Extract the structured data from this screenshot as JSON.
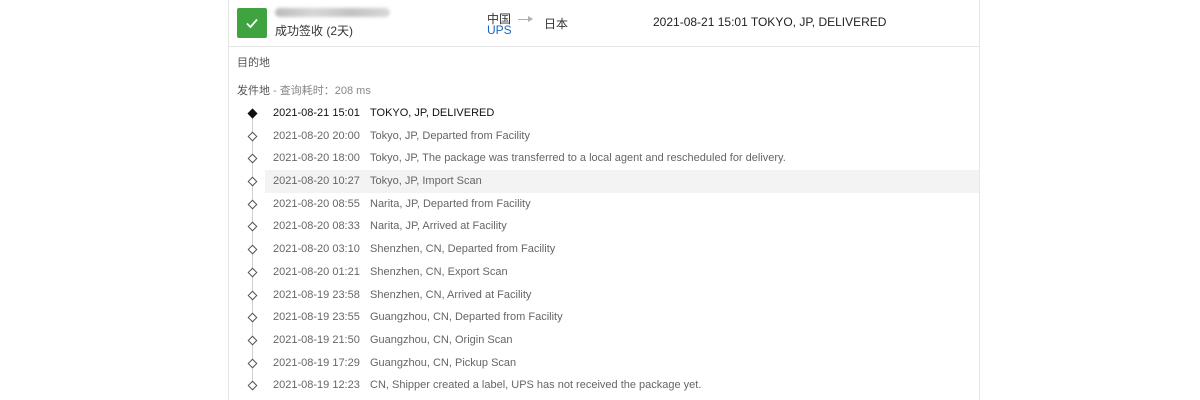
{
  "summary": {
    "status": "成功签收 (2天)",
    "origin_country": "中国",
    "carrier": "UPS",
    "destination_country": "日本",
    "latest_event": "2021-08-21 15:01 TOKYO, JP, DELIVERED",
    "status_color": "#3fa33f",
    "carrier_color": "#1a65c7"
  },
  "sections": {
    "destination_label": "目的地",
    "origin_label": "发件地",
    "query_time": " - 查询耗时：208 ms"
  },
  "events": [
    {
      "time": "2021-08-21 15:01",
      "desc": "TOKYO, JP, DELIVERED"
    },
    {
      "time": "2021-08-20 20:00",
      "desc": "Tokyo, JP, Departed from Facility"
    },
    {
      "time": "2021-08-20 18:00",
      "desc": "Tokyo, JP, The package was transferred to a local agent and rescheduled for delivery."
    },
    {
      "time": "2021-08-20 10:27",
      "desc": "Tokyo, JP, Import Scan"
    },
    {
      "time": "2021-08-20 08:55",
      "desc": "Narita, JP, Departed from Facility"
    },
    {
      "time": "2021-08-20 08:33",
      "desc": "Narita, JP, Arrived at Facility"
    },
    {
      "time": "2021-08-20 03:10",
      "desc": "Shenzhen, CN, Departed from Facility"
    },
    {
      "time": "2021-08-20 01:21",
      "desc": "Shenzhen, CN, Export Scan"
    },
    {
      "time": "2021-08-19 23:58",
      "desc": "Shenzhen, CN, Arrived at Facility"
    },
    {
      "time": "2021-08-19 23:55",
      "desc": "Guangzhou, CN, Departed from Facility"
    },
    {
      "time": "2021-08-19 21:50",
      "desc": "Guangzhou, CN, Origin Scan"
    },
    {
      "time": "2021-08-19 17:29",
      "desc": "Guangzhou, CN, Pickup Scan"
    },
    {
      "time": "2021-08-19 12:23",
      "desc": "CN, Shipper created a label, UPS has not received the package yet."
    }
  ]
}
